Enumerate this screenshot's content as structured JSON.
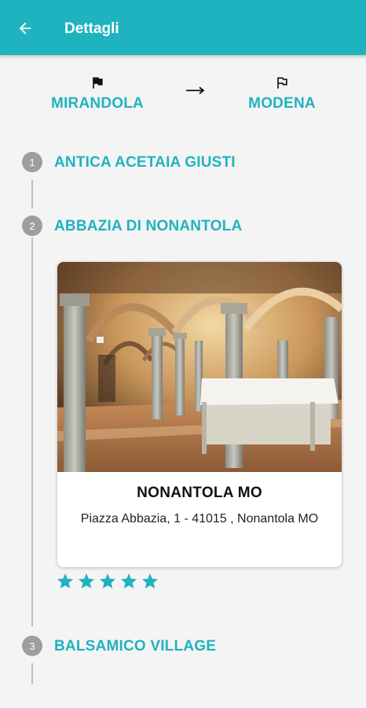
{
  "appbar": {
    "title": "Dettagli",
    "back_icon": "arrow-back-icon"
  },
  "route": {
    "start": {
      "label": "MIRANDOLA",
      "icon": "flag-filled-icon"
    },
    "end": {
      "label": "MODENA",
      "icon": "flag-outline-icon"
    },
    "arrow_icon": "arrow-right-icon"
  },
  "steps": [
    {
      "number": "1",
      "title": "ANTICA ACETAIA GIUSTI"
    },
    {
      "number": "2",
      "title": "ABBAZIA DI NONANTOLA"
    },
    {
      "number": "3",
      "title": "BALSAMICO VILLAGE"
    }
  ],
  "card": {
    "title": "NONANTOLA MO",
    "address": "Piazza Abbazia, 1 - 41015 , Nonantola MO",
    "photo": "abbey-crypt-photo",
    "rating": 5,
    "rating_max": 5
  },
  "colors": {
    "accent": "#1fb3bf",
    "step_circle": "#9e9e9e",
    "timeline": "#bdbdbd",
    "background": "#f4f4f4"
  }
}
